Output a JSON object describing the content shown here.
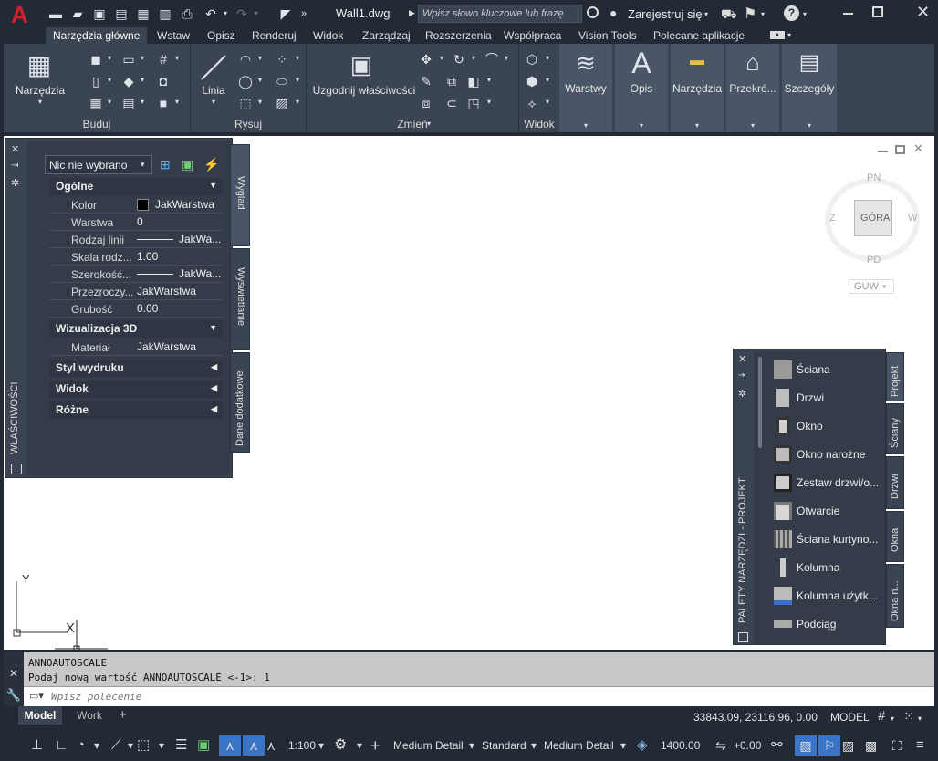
{
  "title": {
    "filename": "Wall1.dwg",
    "search_placeholder": "Wpisz słowo kluczowe lub frazę",
    "signin": "Zarejestruj się"
  },
  "ribbon_tabs": [
    "Narzędzia główne",
    "Wstaw",
    "Opisz",
    "Renderuj",
    "Widok",
    "Zarządzaj",
    "Rozszerzenia",
    "Współpraca",
    "Vision Tools",
    "Polecane aplikacje"
  ],
  "ribbon": {
    "narzedzia": "Narzędzia",
    "linia": "Linia",
    "uzgodnij": "Uzgodnij właściwości",
    "warstwy": "Warstwy",
    "opis": "Opis",
    "narzedzia2": "Narzędzia",
    "przekroj": "Przekró...",
    "szczegoly": "Szczegóły",
    "panel_buduj": "Buduj",
    "panel_rysuj": "Rysuj",
    "panel_zmien": "Zmień",
    "panel_widok": "Widok"
  },
  "properties": {
    "selector": "Nic nie wybrano",
    "palette_title": "WŁAŚCIWOŚCI",
    "sections": {
      "ogolne": "Ogólne",
      "wiz3d": "Wizualizacja 3D",
      "styl": "Styl wydruku",
      "widok": "Widok",
      "rozne": "Różne"
    },
    "rows": [
      {
        "name": "Kolor",
        "value": "JakWarstwa"
      },
      {
        "name": "Warstwa",
        "value": "0"
      },
      {
        "name": "Rodzaj linii",
        "value": "JakWa..."
      },
      {
        "name": "Skala rodz...",
        "value": "1.00"
      },
      {
        "name": "Szerokość...",
        "value": "JakWa..."
      },
      {
        "name": "Przezroczy...",
        "value": "JakWarstwa"
      },
      {
        "name": "Grubość",
        "value": "0.00"
      }
    ],
    "material": {
      "name": "Materiał",
      "value": "JakWarstwa"
    },
    "side_tabs": [
      "Wygląd",
      "Wyświetlanie",
      "Dane dodatkowe"
    ]
  },
  "viewcube": {
    "top": "GÓRA",
    "north": "PN",
    "south": "PD",
    "west": "Z",
    "east": "W",
    "ucs": "GUW"
  },
  "tool_palette": {
    "title": "PALETY NARZĘDZI - PROJEKT",
    "items": [
      "Ściana",
      "Drzwi",
      "Okno",
      "Okno narożne",
      "Zestaw drzwi/o...",
      "Otwarcie",
      "Ściana kurtyno...",
      "Kolumna",
      "Kolumna użytk...",
      "Podciąg"
    ],
    "side_tabs": [
      "Projekt",
      "Ściany",
      "Drzwi",
      "Okna",
      "Okna n..."
    ]
  },
  "command": {
    "line1": "ANNOAUTOSCALE",
    "line2": "Podaj nową wartość ANNOAUTOSCALE <-1>: 1",
    "placeholder": "Wpisz polecenie"
  },
  "layout_tabs": [
    "Model",
    "Work"
  ],
  "status": {
    "coords": "33843.09, 23116.96, 0.00",
    "space": "MODEL",
    "scale": "1:100",
    "detail1": "Medium Detail",
    "standard": "Standard",
    "detail2": "Medium Detail",
    "elevation": "1400.00",
    "offset": "+0.00"
  },
  "colors": {
    "accent": "#3b74c7",
    "ribbon": "#3b4453",
    "dark": "#222a36",
    "logo": "#d0202a"
  }
}
